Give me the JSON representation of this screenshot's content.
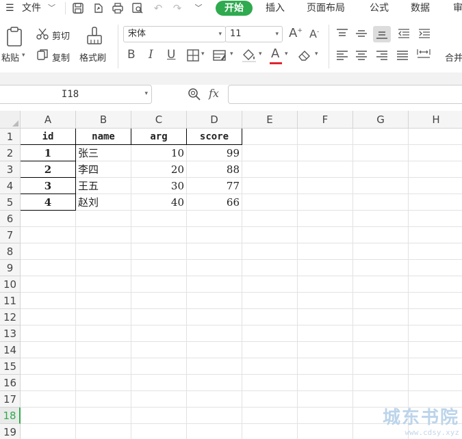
{
  "menubar": {
    "hamburger": "☰",
    "file": "文件",
    "tab_active": "开始",
    "tabs": [
      "插入",
      "页面布局",
      "公式",
      "数据",
      "审"
    ]
  },
  "ribbon": {
    "paste": "粘贴",
    "cut": "剪切",
    "copy": "复制",
    "format_painter": "格式刷",
    "font_name": "宋体",
    "font_size": "11",
    "bold": "B",
    "italic": "I",
    "underline": "U",
    "font_color_letter": "A",
    "merge": "合并",
    "accent_color": "#2faa4f",
    "font_color_bar": "#e0242f"
  },
  "formula_bar": {
    "cell_ref": "I18",
    "fx": "fx",
    "value": ""
  },
  "sheet": {
    "columns": [
      "A",
      "B",
      "C",
      "D",
      "E",
      "F",
      "G",
      "H"
    ],
    "rows": [
      "1",
      "2",
      "3",
      "4",
      "5",
      "6",
      "7",
      "8",
      "9",
      "10",
      "11",
      "12",
      "13",
      "14",
      "15",
      "16",
      "17",
      "18",
      "19"
    ],
    "selected_row": "18",
    "header": [
      "id",
      "name",
      "arg",
      "score"
    ],
    "data": [
      [
        "1",
        "张三",
        "10",
        "99"
      ],
      [
        "2",
        "李四",
        "20",
        "88"
      ],
      [
        "3",
        "王五",
        "30",
        "77"
      ],
      [
        "4",
        "赵刘",
        "40",
        "66"
      ]
    ]
  },
  "watermark": {
    "line1": "城东书院",
    "line2": "www.cdsy.xyz"
  }
}
